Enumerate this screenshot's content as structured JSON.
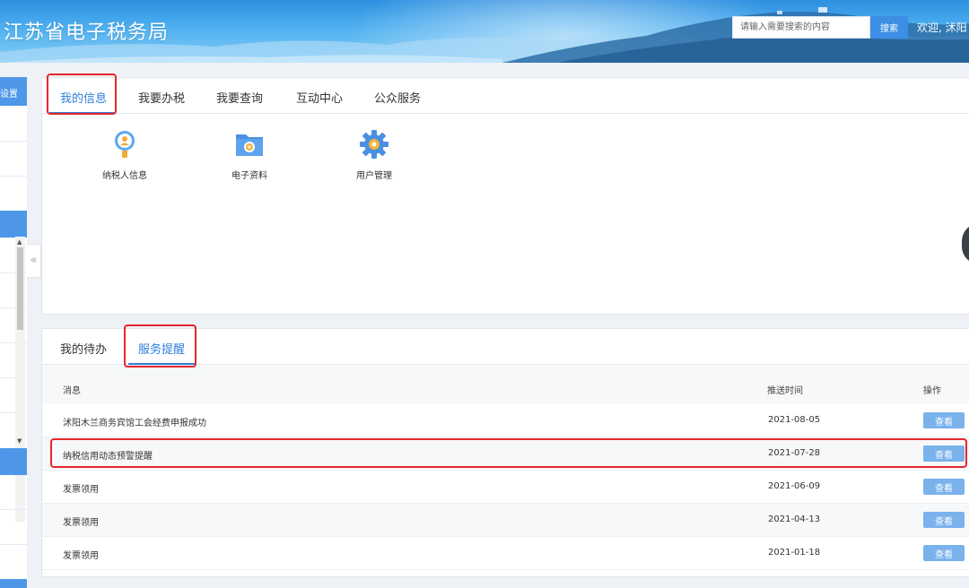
{
  "header": {
    "site_title": "江苏省电子税务局",
    "search_placeholder": "请输入需要搜索的内容",
    "search_label": "搜索",
    "welcome_text": "欢迎, 沭阳"
  },
  "sidebar": {
    "top_label": "设置",
    "collapse_glyph": "«"
  },
  "top_panel": {
    "tabs": [
      {
        "label": "我的信息",
        "active": true
      },
      {
        "label": "我要办税",
        "active": false
      },
      {
        "label": "我要查询",
        "active": false
      },
      {
        "label": "互动中心",
        "active": false
      },
      {
        "label": "公众服务",
        "active": false
      }
    ],
    "tiles": [
      {
        "label": "纳税人信息",
        "icon": "taxpayer-info-icon"
      },
      {
        "label": "电子资料",
        "icon": "electronic-documents-icon"
      },
      {
        "label": "用户管理",
        "icon": "user-management-icon"
      }
    ]
  },
  "bottom_panel": {
    "tabs": [
      {
        "label": "我的待办",
        "active": false
      },
      {
        "label": "服务提醒",
        "active": true
      }
    ],
    "columns": {
      "message": "消息",
      "time": "推送时间",
      "action": "操作"
    },
    "rows": [
      {
        "message": "沭阳木兰商务宾馆工会经费申报成功",
        "time": "2021-08-05",
        "action": "查看"
      },
      {
        "message": "纳税信用动态预警提醒",
        "time": "2021-07-28",
        "action": "查看"
      },
      {
        "message": "发票领用",
        "time": "2021-06-09",
        "action": "查看"
      },
      {
        "message": "发票领用",
        "time": "2021-04-13",
        "action": "查看"
      },
      {
        "message": "发票领用",
        "time": "2021-01-18",
        "action": "查看"
      }
    ]
  },
  "colors": {
    "accent": "#2f7fd8",
    "highlight_box": "#e8262a",
    "view_button": "#7ab2ec"
  }
}
